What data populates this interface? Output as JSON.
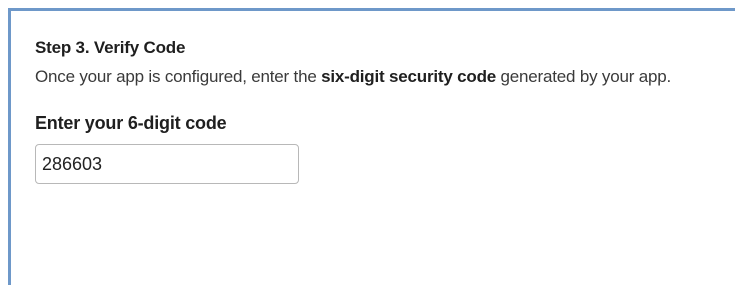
{
  "step": {
    "title": "Step 3. Verify Code",
    "description_before": "Once your app is configured, enter the ",
    "description_emphasis": "six-digit security code",
    "description_after": " generated by your app."
  },
  "code_field": {
    "label": "Enter your 6-digit code",
    "value": "286603"
  },
  "colors": {
    "panel_border": "#6e98c9",
    "input_border": "#b8b8b8"
  }
}
